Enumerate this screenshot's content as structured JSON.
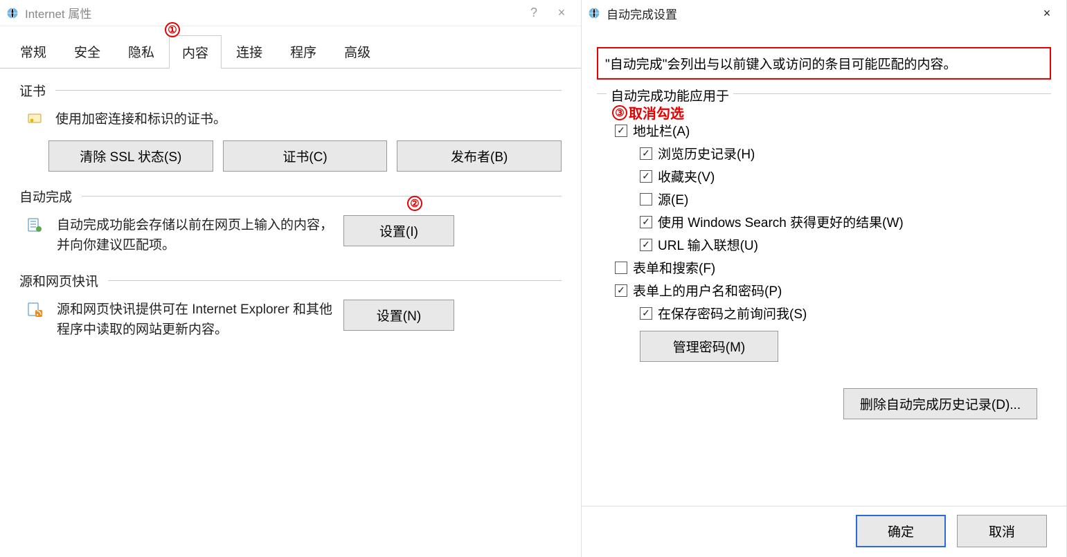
{
  "left": {
    "title": "Internet 属性",
    "help_label": "?",
    "close_label": "×",
    "tabs": [
      "常规",
      "安全",
      "隐私",
      "内容",
      "连接",
      "程序",
      "高级"
    ],
    "active_tab_index": 3,
    "groups": {
      "cert": {
        "title": "证书",
        "desc": "使用加密连接和标识的证书。",
        "buttons": {
          "clear_ssl": "清除 SSL 状态(S)",
          "certs": "证书(C)",
          "publishers": "发布者(B)"
        }
      },
      "autocomplete": {
        "title": "自动完成",
        "desc": "自动完成功能会存储以前在网页上输入的内容，并向你建议匹配项。",
        "button": "设置(I)"
      },
      "feeds": {
        "title": "源和网页快讯",
        "desc": "源和网页快讯提供可在 Internet Explorer 和其他程序中读取的网站更新内容。",
        "button": "设置(N)"
      }
    },
    "annotations": {
      "a1": "①",
      "a2": "②"
    }
  },
  "right": {
    "title": "自动完成设置",
    "close_label": "×",
    "info": "\"自动完成\"会列出与以前键入或访问的条目可能匹配的内容。",
    "group_legend": "自动完成功能应用于",
    "annot3_num": "③",
    "annot3_text": "取消勾选",
    "checkboxes": {
      "address_bar": {
        "label": "地址栏(A)",
        "checked": true
      },
      "history": {
        "label": "浏览历史记录(H)",
        "checked": true
      },
      "favorites": {
        "label": "收藏夹(V)",
        "checked": true
      },
      "feeds": {
        "label": "源(E)",
        "checked": false
      },
      "win_search": {
        "label": "使用 Windows Search 获得更好的结果(W)",
        "checked": true
      },
      "url_suggest": {
        "label": "URL 输入联想(U)",
        "checked": true
      },
      "forms_search": {
        "label": "表单和搜索(F)",
        "checked": false
      },
      "user_pass": {
        "label": "表单上的用户名和密码(P)",
        "checked": true
      },
      "ask_save": {
        "label": "在保存密码之前询问我(S)",
        "checked": true
      }
    },
    "manage_passwords": "管理密码(M)",
    "delete_history": "删除自动完成历史记录(D)...",
    "ok": "确定",
    "cancel": "取消"
  }
}
